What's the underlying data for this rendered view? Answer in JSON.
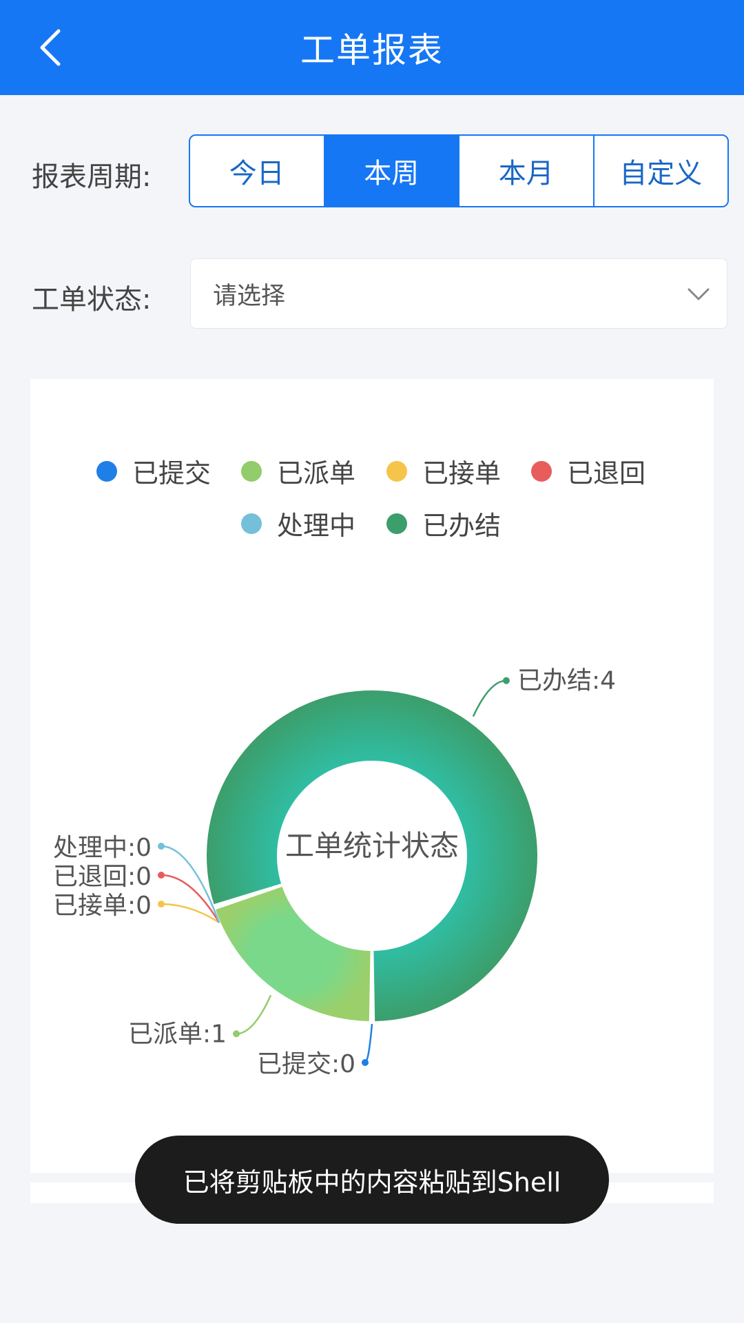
{
  "header": {
    "title": "工单报表"
  },
  "filters": {
    "period_label": "报表周期:",
    "period_options": [
      "今日",
      "本周",
      "本月",
      "自定义"
    ],
    "period_selected": "本周",
    "status_label": "工单状态:",
    "status_placeholder": "请选择"
  },
  "chart_data": {
    "type": "pie",
    "center_title": "工单统计状态",
    "categories": [
      "已提交",
      "已派单",
      "已接单",
      "已退回",
      "处理中",
      "已办结"
    ],
    "values": [
      0,
      1,
      0,
      0,
      0,
      4
    ],
    "colors": [
      "#1f7fe6",
      "#93cc6b",
      "#f5c44a",
      "#e85c5c",
      "#74c0d9",
      "#3c9e6b"
    ],
    "data_labels": [
      "已提交:0",
      "已派单:1",
      "已接单:0",
      "已退回:0",
      "处理中:0",
      "已办结:4"
    ],
    "legend": [
      "已提交",
      "已派单",
      "已接单",
      "已退回",
      "处理中",
      "已办结"
    ],
    "legend_position": "top"
  },
  "toast": {
    "text": "已将剪贴板中的内容粘贴到Shell"
  }
}
